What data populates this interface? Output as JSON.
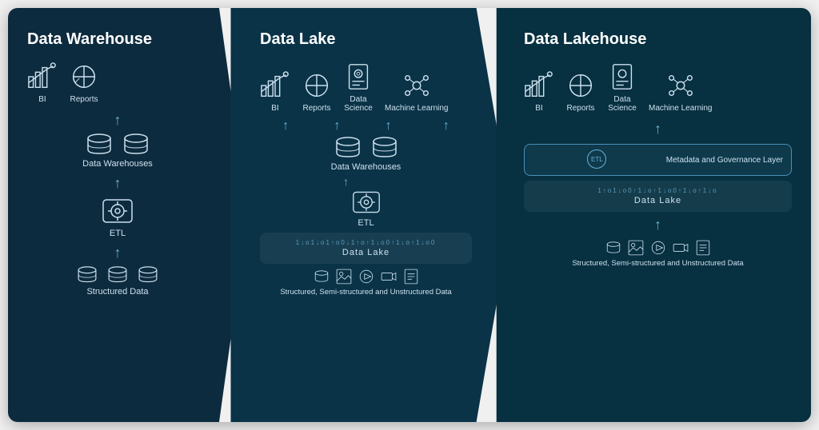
{
  "panels": [
    {
      "id": "warehouse",
      "title": "Data Warehouse",
      "icons": [
        {
          "label": "BI",
          "type": "bi"
        },
        {
          "label": "Reports",
          "type": "reports"
        }
      ],
      "storage_label": "Data Warehouses",
      "etl_label": "ETL",
      "source_label": "Structured Data",
      "source_icons": [
        "database",
        "database",
        "database"
      ]
    },
    {
      "id": "lake",
      "title": "Data Lake",
      "icons": [
        {
          "label": "BI",
          "type": "bi"
        },
        {
          "label": "Reports",
          "type": "reports"
        },
        {
          "label": "Data Science",
          "type": "science"
        },
        {
          "label": "Machine Learning",
          "type": "ml"
        }
      ],
      "storage_label": "Data Warehouses",
      "etl_label": "ETL",
      "lake_label": "Data Lake",
      "source_label": "Structured, Semi-structured and Unstructured Data",
      "source_icons": [
        "database",
        "image",
        "video",
        "audio",
        "doc"
      ]
    },
    {
      "id": "lakehouse",
      "title": "Data Lakehouse",
      "icons": [
        {
          "label": "BI",
          "type": "bi"
        },
        {
          "label": "Reports",
          "type": "reports"
        },
        {
          "label": "Data Science",
          "type": "science"
        },
        {
          "label": "Machine Learning",
          "type": "ml"
        }
      ],
      "metadata_label": "Metadata and Governance Layer",
      "etl_label": "ETL",
      "lake_label": "Data Lake",
      "source_label": "Structured, Semi-structured and Unstructured Data",
      "source_icons": [
        "database",
        "image",
        "video",
        "audio",
        "doc"
      ]
    }
  ]
}
